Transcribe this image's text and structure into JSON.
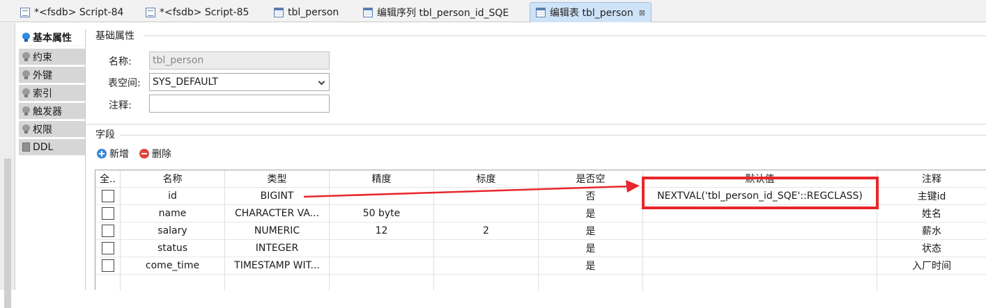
{
  "tabs": [
    {
      "label": "*<fsdb> Script-84",
      "icon": "script-icon",
      "active": false
    },
    {
      "label": "*<fsdb> Script-85",
      "icon": "script-icon",
      "active": false
    },
    {
      "label": "tbl_person",
      "icon": "table-icon",
      "active": false
    },
    {
      "label": "编辑序列 tbl_person_id_SQE",
      "icon": "table-icon",
      "active": false
    },
    {
      "label": "编辑表 tbl_person",
      "icon": "table-icon",
      "active": true,
      "close": "⊠"
    }
  ],
  "sidenav": [
    {
      "label": "基本属性",
      "icon": "bulb-icon",
      "active": true
    },
    {
      "label": "约束",
      "icon": "bulb-icon"
    },
    {
      "label": "外键",
      "icon": "bulb-icon"
    },
    {
      "label": "索引",
      "icon": "bulb-icon"
    },
    {
      "label": "触发器",
      "icon": "bulb-icon"
    },
    {
      "label": "权限",
      "icon": "bulb-icon"
    },
    {
      "label": "DDL",
      "icon": "ddl-icon"
    }
  ],
  "basic": {
    "section_title": "基础属性",
    "name_label": "名称:",
    "name_value": "tbl_person",
    "tablespace_label": "表空间:",
    "tablespace_value": "SYS_DEFAULT",
    "comment_label": "注释:",
    "comment_value": ""
  },
  "fields": {
    "section_title": "字段",
    "add_label": "新增",
    "delete_label": "删除",
    "columns": [
      "全..",
      "名称",
      "类型",
      "精度",
      "标度",
      "是否空",
      "默认值",
      "注释"
    ],
    "rows": [
      {
        "name": "id",
        "type": "BIGINT",
        "precision": "",
        "scale": "",
        "nullable": "否",
        "default": "NEXTVAL('tbl_person_id_SQE'::REGCLASS)",
        "comment": "主键id"
      },
      {
        "name": "name",
        "type": "CHARACTER VA...",
        "precision": "50 byte",
        "scale": "",
        "nullable": "是",
        "default": "",
        "comment": "姓名"
      },
      {
        "name": "salary",
        "type": "NUMERIC",
        "precision": "12",
        "scale": "2",
        "nullable": "是",
        "default": "",
        "comment": "薪水"
      },
      {
        "name": "status",
        "type": "INTEGER",
        "precision": "",
        "scale": "",
        "nullable": "是",
        "default": "",
        "comment": "状态"
      },
      {
        "name": "come_time",
        "type": "TIMESTAMP WIT...",
        "precision": "",
        "scale": "",
        "nullable": "是",
        "default": "",
        "comment": "入厂时间"
      }
    ]
  },
  "colors": {
    "annotation_red": "#e8262b",
    "active_tab": "#cfe3f8",
    "nav_bg": "#d6d6d6"
  }
}
